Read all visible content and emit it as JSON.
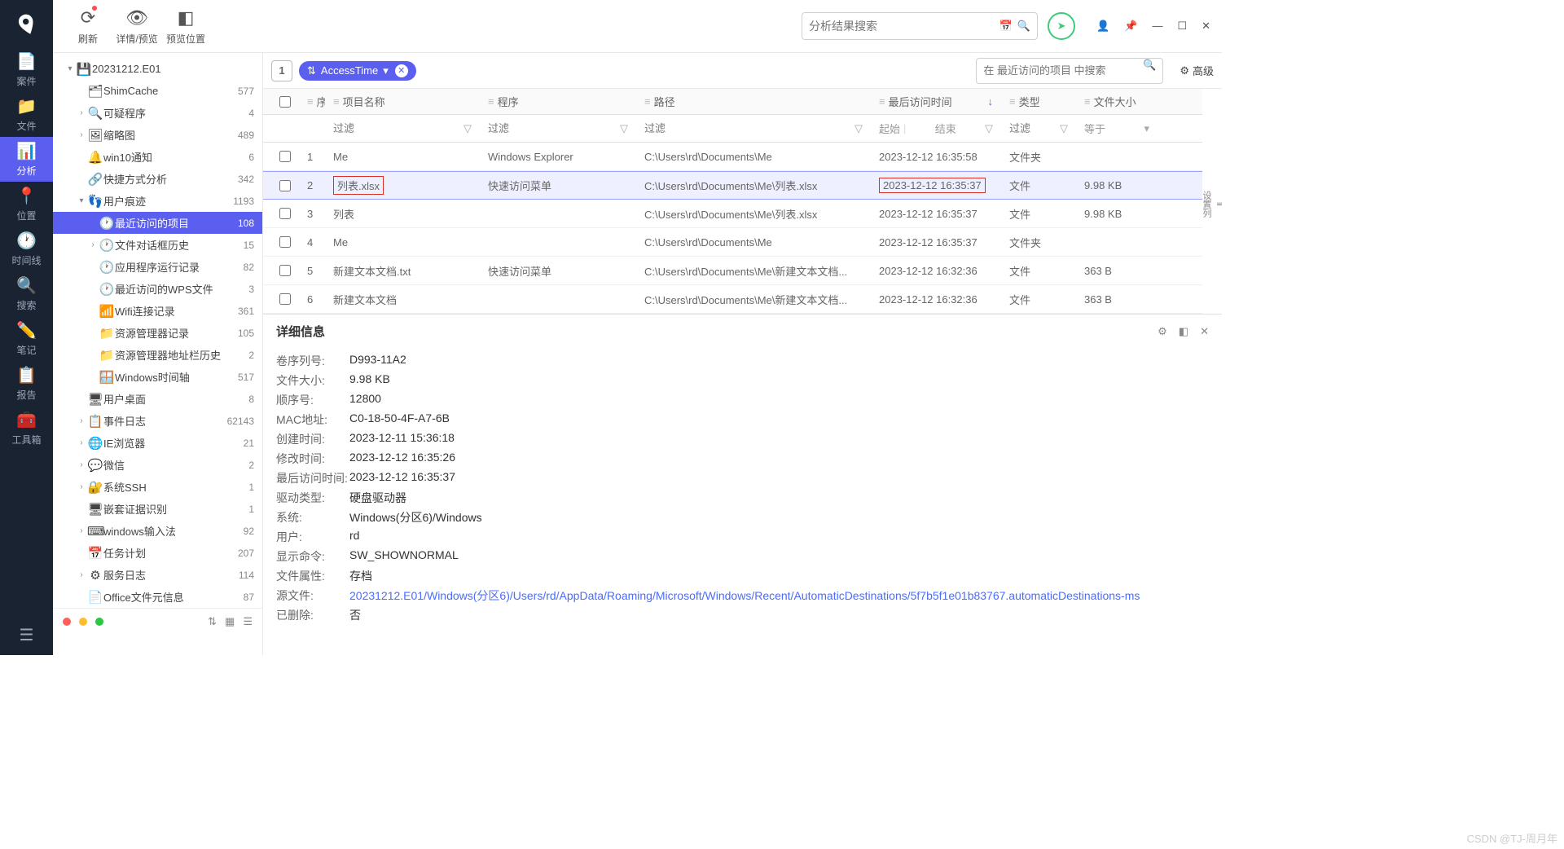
{
  "leftnav": {
    "items": [
      {
        "label": "案件",
        "icon": "📄"
      },
      {
        "label": "文件",
        "icon": "📁"
      },
      {
        "label": "分析",
        "icon": "📊",
        "active": true
      },
      {
        "label": "位置",
        "icon": "📍"
      },
      {
        "label": "时间线",
        "icon": "🕐"
      },
      {
        "label": "搜索",
        "icon": "🔍"
      },
      {
        "label": "笔记",
        "icon": "✏️"
      },
      {
        "label": "报告",
        "icon": "📋"
      },
      {
        "label": "工具箱",
        "icon": "🧰"
      }
    ]
  },
  "toolbar": {
    "refresh": "刷新",
    "detail_preview": "详情/预览",
    "preview_pos": "预览位置",
    "search_placeholder": "分析结果搜索"
  },
  "tree": {
    "root": "20231212.E01",
    "items": [
      {
        "indent": 1,
        "chev": "▾",
        "icon": "💾",
        "label": "20231212.E01",
        "count": ""
      },
      {
        "indent": 2,
        "chev": "",
        "icon": "🗂",
        "label": "ShimCache",
        "count": "577"
      },
      {
        "indent": 2,
        "chev": "›",
        "icon": "🔍",
        "label": "可疑程序",
        "count": "4"
      },
      {
        "indent": 2,
        "chev": "›",
        "icon": "🖼",
        "label": "缩略图",
        "count": "489"
      },
      {
        "indent": 2,
        "chev": "",
        "icon": "🔔",
        "label": "win10通知",
        "count": "6"
      },
      {
        "indent": 2,
        "chev": "",
        "icon": "🔗",
        "label": "快捷方式分析",
        "count": "342"
      },
      {
        "indent": 2,
        "chev": "▾",
        "icon": "👣",
        "label": "用户痕迹",
        "count": "1193"
      },
      {
        "indent": 3,
        "chev": "",
        "icon": "🕐",
        "label": "最近访问的项目",
        "count": "108",
        "active": true
      },
      {
        "indent": 3,
        "chev": "›",
        "icon": "🕐",
        "label": "文件对话框历史",
        "count": "15"
      },
      {
        "indent": 3,
        "chev": "",
        "icon": "🕐",
        "label": "应用程序运行记录",
        "count": "82"
      },
      {
        "indent": 3,
        "chev": "",
        "icon": "🕐",
        "label": "最近访问的WPS文件",
        "count": "3"
      },
      {
        "indent": 3,
        "chev": "",
        "icon": "📶",
        "label": "Wifi连接记录",
        "count": "361"
      },
      {
        "indent": 3,
        "chev": "",
        "icon": "📁",
        "label": "资源管理器记录",
        "count": "105"
      },
      {
        "indent": 3,
        "chev": "",
        "icon": "📁",
        "label": "资源管理器地址栏历史",
        "count": "2"
      },
      {
        "indent": 3,
        "chev": "",
        "icon": "🪟",
        "label": "Windows时间轴",
        "count": "517"
      },
      {
        "indent": 2,
        "chev": "",
        "icon": "🖥",
        "label": "用户桌面",
        "count": "8"
      },
      {
        "indent": 2,
        "chev": "›",
        "icon": "📋",
        "label": "事件日志",
        "count": "62143"
      },
      {
        "indent": 2,
        "chev": "›",
        "icon": "🌐",
        "label": "IE浏览器",
        "count": "21"
      },
      {
        "indent": 2,
        "chev": "›",
        "icon": "💬",
        "label": "微信",
        "count": "2"
      },
      {
        "indent": 2,
        "chev": "›",
        "icon": "🔐",
        "label": "系统SSH",
        "count": "1"
      },
      {
        "indent": 2,
        "chev": "",
        "icon": "🖥",
        "label": "嵌套证据识别",
        "count": "1"
      },
      {
        "indent": 2,
        "chev": "›",
        "icon": "⌨",
        "label": "windows输入法",
        "count": "92"
      },
      {
        "indent": 2,
        "chev": "",
        "icon": "📅",
        "label": "任务计划",
        "count": "207"
      },
      {
        "indent": 2,
        "chev": "›",
        "icon": "⚙",
        "label": "服务日志",
        "count": "114"
      },
      {
        "indent": 2,
        "chev": "",
        "icon": "📄",
        "label": "Office文件元信息",
        "count": "87"
      }
    ]
  },
  "grid_toolbar": {
    "chip": "AccessTime",
    "search_placeholder": "在 最近访问的项目 中搜索",
    "advanced": "高级"
  },
  "grid": {
    "headers": {
      "seq": "序号",
      "name": "项目名称",
      "prog": "程序",
      "path": "路径",
      "time": "最后访问时间",
      "type": "类型",
      "size": "文件大小"
    },
    "filters": {
      "text": "过滤",
      "start": "起始",
      "end": "结束",
      "eq": "等于"
    },
    "rows": [
      {
        "seq": "1",
        "name": "Me",
        "prog": "Windows Explorer",
        "path": "C:\\Users\\rd\\Documents\\Me",
        "time": "2023-12-12 16:35:58",
        "type": "文件夹",
        "size": ""
      },
      {
        "seq": "2",
        "name": "列表.xlsx",
        "prog": "快速访问菜单",
        "path": "C:\\Users\\rd\\Documents\\Me\\列表.xlsx",
        "time": "2023-12-12 16:35:37",
        "type": "文件",
        "size": "9.98 KB",
        "sel": true,
        "highlight": true
      },
      {
        "seq": "3",
        "name": "列表",
        "prog": "",
        "path": "C:\\Users\\rd\\Documents\\Me\\列表.xlsx",
        "time": "2023-12-12 16:35:37",
        "type": "文件",
        "size": "9.98 KB"
      },
      {
        "seq": "4",
        "name": "Me",
        "prog": "",
        "path": "C:\\Users\\rd\\Documents\\Me",
        "time": "2023-12-12 16:35:37",
        "type": "文件夹",
        "size": ""
      },
      {
        "seq": "5",
        "name": "新建文本文档.txt",
        "prog": "快速访问菜单",
        "path": "C:\\Users\\rd\\Documents\\Me\\新建文本文档...",
        "time": "2023-12-12 16:32:36",
        "type": "文件",
        "size": "363 B"
      },
      {
        "seq": "6",
        "name": "新建文本文档",
        "prog": "",
        "path": "C:\\Users\\rd\\Documents\\Me\\新建文本文档...",
        "time": "2023-12-12 16:32:36",
        "type": "文件",
        "size": "363 B"
      }
    ],
    "settings_col": "设置列"
  },
  "detail": {
    "title": "详细信息",
    "rows": [
      {
        "k": "卷序列号:",
        "v": "D993-11A2"
      },
      {
        "k": "文件大小:",
        "v": "9.98 KB"
      },
      {
        "k": "顺序号:",
        "v": "12800"
      },
      {
        "k": "MAC地址:",
        "v": "C0-18-50-4F-A7-6B"
      },
      {
        "k": "创建时间:",
        "v": "2023-12-11 15:36:18"
      },
      {
        "k": "修改时间:",
        "v": "2023-12-12 16:35:26"
      },
      {
        "k": "最后访问时间:",
        "v": "2023-12-12 16:35:37"
      },
      {
        "k": "驱动类型:",
        "v": "硬盘驱动器"
      },
      {
        "k": "系统:",
        "v": "Windows(分区6)/Windows"
      },
      {
        "k": "用户:",
        "v": "rd"
      },
      {
        "k": "显示命令:",
        "v": "SW_SHOWNORMAL"
      },
      {
        "k": "文件属性:",
        "v": "存档"
      },
      {
        "k": "源文件:",
        "v": "20231212.E01/Windows(分区6)/Users/rd/AppData/Roaming/Microsoft/Windows/Recent/AutomaticDestinations/5f7b5f1e01b83767.automaticDestinations-ms",
        "link": true
      },
      {
        "k": "已删除:",
        "v": "否"
      }
    ]
  },
  "watermark": "CSDN @TJ-周月年"
}
